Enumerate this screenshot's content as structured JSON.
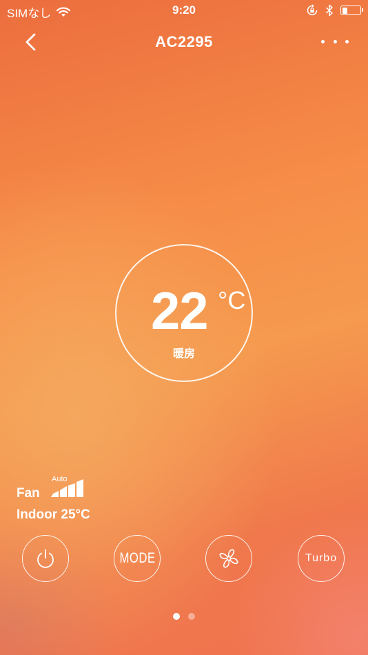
{
  "status_bar": {
    "carrier": "SIMなし",
    "time": "9:20",
    "battery_level": 0.3,
    "icons": [
      "wifi-icon",
      "rotation-lock-icon",
      "bluetooth-icon",
      "battery-icon"
    ]
  },
  "navbar": {
    "title": "AC2295",
    "back_icon": "chevron-left-icon",
    "more_icon": "more-dots-icon"
  },
  "dial": {
    "temperature": "22",
    "unit": "°C",
    "mode": "暖房"
  },
  "fan": {
    "label": "Fan",
    "speed": "Auto",
    "icon": "fan-speed-bars-icon"
  },
  "indoor": {
    "text": "Indoor 25°C"
  },
  "controls": {
    "power_icon": "power-icon",
    "mode_label": "MODE",
    "fan_icon": "fan-icon",
    "turbo_label": "Turbo"
  },
  "pager": {
    "pages": 2,
    "current": 1
  }
}
